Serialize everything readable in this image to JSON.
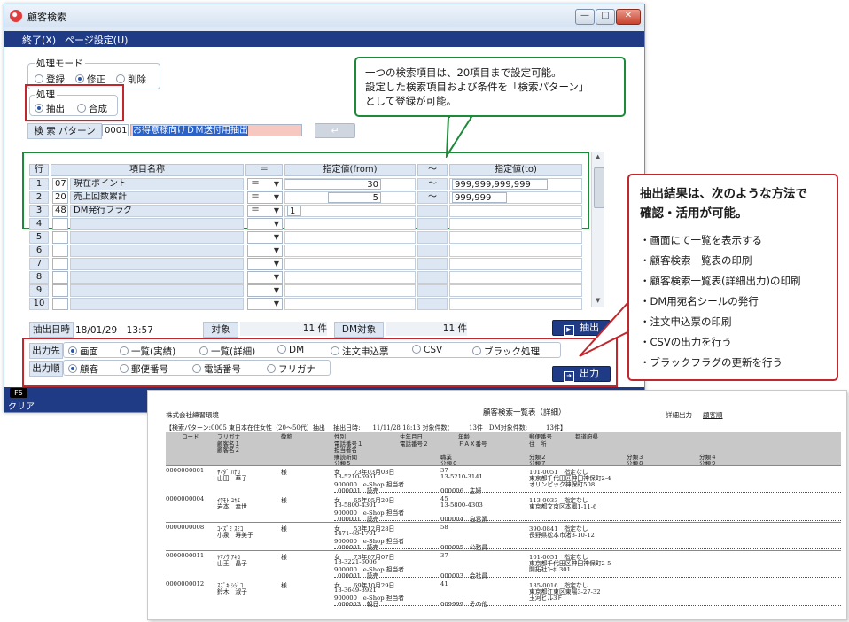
{
  "window": {
    "title": "顧客検索",
    "controls": [
      "—",
      "□",
      "✕"
    ],
    "menu": [
      "終了(X)",
      "ページ設定(U)"
    ]
  },
  "mode": {
    "legend": "処理モード",
    "options": [
      "登録",
      "修正",
      "削除"
    ],
    "selected": "修正"
  },
  "process": {
    "legend": "処理",
    "options": [
      "抽出",
      "合成"
    ],
    "selected": "抽出"
  },
  "search_pattern": {
    "label": "検 索 パターン",
    "code": "0001",
    "name": "お得意様向けＤＭ送付用抽出",
    "enter_symbol": "↵"
  },
  "criteria": {
    "headers": [
      "行",
      "項目名称",
      "＝",
      "指定値(from)",
      "～",
      "指定値(to)"
    ],
    "rows": [
      {
        "no": "1",
        "code": "07",
        "name": "現在ポイント",
        "op": "＝",
        "from": "30",
        "tilde": "～",
        "to": "999,999,999,999"
      },
      {
        "no": "2",
        "code": "20",
        "name": "売上回数累計",
        "op": "＝",
        "from": "5",
        "tilde": "～",
        "to": "999,999"
      },
      {
        "no": "3",
        "code": "48",
        "name": "DM発行フラグ",
        "op": "＝",
        "from": "1",
        "tilde": "",
        "to": ""
      },
      {
        "no": "4",
        "code": "",
        "name": "",
        "op": "",
        "from": "",
        "tilde": "",
        "to": ""
      },
      {
        "no": "5",
        "code": "",
        "name": "",
        "op": "",
        "from": "",
        "tilde": "",
        "to": ""
      },
      {
        "no": "6",
        "code": "",
        "name": "",
        "op": "",
        "from": "",
        "tilde": "",
        "to": ""
      },
      {
        "no": "7",
        "code": "",
        "name": "",
        "op": "",
        "from": "",
        "tilde": "",
        "to": ""
      },
      {
        "no": "8",
        "code": "",
        "name": "",
        "op": "",
        "from": "",
        "tilde": "",
        "to": ""
      },
      {
        "no": "9",
        "code": "",
        "name": "",
        "op": "",
        "from": "",
        "tilde": "",
        "to": ""
      },
      {
        "no": "10",
        "code": "",
        "name": "",
        "op": "",
        "from": "",
        "tilde": "",
        "to": ""
      }
    ]
  },
  "status": {
    "extract_label": "抽出日時",
    "extract_value": "18/01/29　13:57",
    "target_label": "対象",
    "target_value": "11 件",
    "dm_label": "DM対象",
    "dm_value": "11 件"
  },
  "output_dest": {
    "label": "出力先",
    "options": [
      "画面",
      "一覧(実績)",
      "一覧(詳細)",
      "DM",
      "注文申込票",
      "CSV",
      "ブラック処理"
    ],
    "selected": "画面"
  },
  "output_order": {
    "label": "出力順",
    "options": [
      "顧客",
      "郵便番号",
      "電話番号",
      "フリガナ"
    ],
    "selected": "顧客"
  },
  "buttons": {
    "extract": "抽出",
    "output": "出力"
  },
  "footer": {
    "fkey": "F5",
    "label": "クリア"
  },
  "callout_top": {
    "lines": [
      "一つの検索項目は、20項目まで設定可能。",
      "設定した検索項目および条件を「検索パターン」",
      "として登録が可能。"
    ]
  },
  "callout_right": {
    "heading": [
      "抽出結果は、次のような方法で",
      "確認・活用が可能。"
    ],
    "items": [
      "・画面にて一覧を表示する",
      "・顧客検索一覧表の印刷",
      "・顧客検索一覧表(詳細出力)の印刷",
      "・DM用宛名シールの発行",
      "・注文申込票の印刷",
      "・CSVの出力を行う",
      "・ブラックフラグの更新を行う"
    ]
  },
  "report": {
    "company": "株式会社練習環境",
    "title": "顧客検索一覧表（詳細）",
    "detail_label": "詳細出力",
    "order_label": "顧客順",
    "condition": "【検索パターン:0005 東日本在住女性（20～50代）抽出　 抽出日時:　　11/11/28 18:13 対象件数：　　　13件　DM対象件数:　　　13件】",
    "header_rows": [
      [
        "コード",
        "フリガナ",
        "敬称",
        "性別",
        "生年月日",
        "年齢",
        "郵便番号",
        "都道府県"
      ],
      [
        "",
        "顧客名１",
        "",
        "電話番号１",
        "電話番号２",
        "ＦＡＸ番号",
        "住　所",
        ""
      ],
      [
        "",
        "顧客名２",
        "",
        "担当者名",
        "",
        "",
        "",
        ""
      ],
      [
        "",
        "",
        "",
        "購読新聞",
        "職業",
        "",
        "分類２",
        "分類３",
        "分類４"
      ],
      [
        "",
        "",
        "",
        "分類５",
        "分類６",
        "",
        "分類７",
        "分類８",
        "分類９"
      ]
    ],
    "records": [
      {
        "code": "0000000001",
        "kana": "ﾔﾏﾀﾞ ﾊﾅｺ",
        "name": "山田　華子",
        "title": "様",
        "sex": "女",
        "birth": "73年03月03日",
        "age": "37",
        "tel1": "13-5210-5951",
        "tel2": "13-5210-3141",
        "staff": "900000　e-Shop 担当者",
        "news": "000001　読売",
        "job": "000006　主婦",
        "zip": "101-0051　指定なし",
        "addr1": "東京都千代田区神田神保町2-4",
        "addr2": "オリンピック神保町508"
      },
      {
        "code": "0000000004",
        "kana": "ｲﾜﾓﾄ ﾕｷｴ",
        "name": "岩本　幸世",
        "title": "様",
        "sex": "女",
        "birth": "65年05月20日",
        "age": "45",
        "tel1": "13-5800-4301",
        "tel2": "13-5800-4303",
        "staff": "900000　e-Shop 担当者",
        "news": "000001　読売",
        "job": "000004　自営業",
        "zip": "113-0033　指定なし",
        "addr1": "東京都文京区本郷1-11-6",
        "addr2": ""
      },
      {
        "code": "0000000008",
        "kana": "ｺｲｽﾞﾐ ｽﾐｺ",
        "name": "小泉　寿美子",
        "title": "様",
        "sex": "女",
        "birth": "53年12月28日",
        "age": "58",
        "tel1": "1471-48-1701",
        "tel2": "",
        "staff": "900000　e-Shop 担当者",
        "news": "000001　読売",
        "job": "000005　公務員",
        "zip": "390-0841　指定なし",
        "addr1": "長野県松本市渚3-10-12",
        "addr2": ""
      },
      {
        "code": "0000000011",
        "kana": "ﾔﾏﾉｳ ｱｷｺ",
        "name": "山王　晶子",
        "title": "様",
        "sex": "女",
        "birth": "73年07月07日",
        "age": "37",
        "tel1": "13-3221-6006",
        "tel2": "",
        "staff": "900000　e-Shop 担当者",
        "news": "000001　読売",
        "job": "000003　会社員",
        "zip": "101-0051　指定なし",
        "addr1": "東京都千代田区神田神保町2-5",
        "addr2": "開拓社ｺｰﾎﾟ301"
      },
      {
        "code": "0000000012",
        "kana": "ｽｽﾞｷ ｼｼﾞｺ",
        "name": "鈴木　淑子",
        "title": "様",
        "sex": "女",
        "birth": "69年10月29日",
        "age": "41",
        "tel1": "13-3649-3921",
        "tel2": "",
        "staff": "900000　e-Shop 担当者",
        "news": "000003　朝日",
        "job": "009999　その他",
        "zip": "135-0016　指定なし",
        "addr1": "東京都江東区東陽3-27-32",
        "addr2": "玉河ビル3Ｆ"
      }
    ]
  },
  "colors": {
    "accent_red": "#c0282d",
    "accent_green": "#1d8a3a",
    "navy": "#1f3b86",
    "label_blue": "#dde6f3"
  }
}
